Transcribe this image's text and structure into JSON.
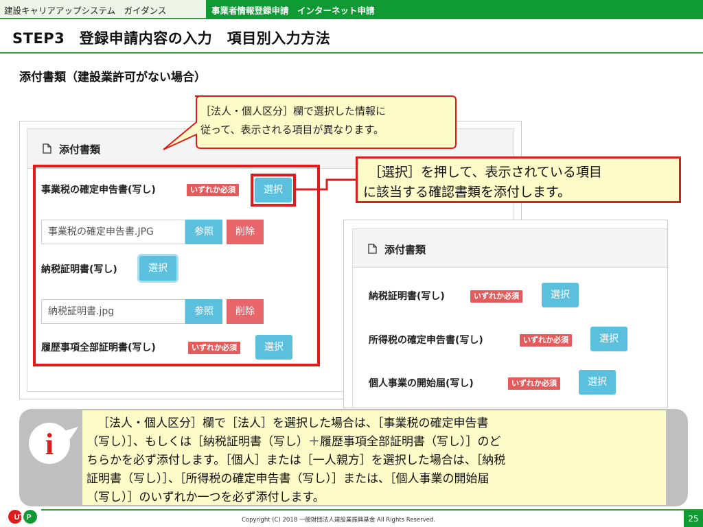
{
  "header": {
    "left_label": "建設キャリアアップシステム　ガイダンス",
    "right_label": "事業者情報登録申請　インターネット申請"
  },
  "title": "STEP3　登録申請内容の入力　項目別入力方法",
  "subtitle": "添付書類（建設業許可がない場合）",
  "bubble": {
    "line1": "［法人・個人区分］欄で選択した情報に",
    "line2": "従って、表示される項目が異なります。"
  },
  "panel_corp": {
    "heading": "添付書類",
    "items": [
      {
        "label": "事業税の確定申告書(写し)",
        "badge": "いずれか必須",
        "select": "選択"
      },
      {
        "file_name": "事業税の確定申告書.JPG",
        "ref": "参照",
        "delete": "削除"
      },
      {
        "label": "納税証明書(写し)",
        "select": "選択"
      },
      {
        "file_name": "納税証明書.jpg",
        "ref": "参照",
        "delete": "削除"
      },
      {
        "label": "履歴事項全部証明書(写し)",
        "badge": "いずれか必須",
        "select": "選択"
      }
    ]
  },
  "callout_red": {
    "line1": "［選択］を押して、表示されている項目",
    "line2": "に該当する確認書類を添付します。"
  },
  "panel_indiv": {
    "heading": "添付書類",
    "items": [
      {
        "label": "納税証明書(写し)",
        "badge": "いずれか必須",
        "select": "選択"
      },
      {
        "label": "所得税の確定申告書(写し)",
        "badge": "いずれか必須",
        "select": "選択"
      },
      {
        "label": "個人事業の開始届(写し)",
        "badge": "いずれか必須",
        "select": "選択"
      }
    ]
  },
  "info": {
    "icon_letter": "i",
    "lines": [
      "［法人・個人区分］欄で［法人］を選択した場合は、［事業税の確定申告書",
      "（写し）］、もしくは［納税証明書（写し）＋履歴事項全部証明書（写し）］のど",
      "ちらかを必ず添付します。［個人］または［一人親方］を選択した場合は、［納税",
      "証明書（写し）］、［所得税の確定申告書（写し）］または、［個人事業の開始届",
      "（写し）］のいずれか一つを必ず添付します。"
    ]
  },
  "footer": {
    "copyright": "Copyright (C) 2018 一般財団法人建設業振興基金 All Rights Reserved.",
    "page_number": "25",
    "logo_text": "UT P"
  },
  "colors": {
    "brand_green": "#0f9a34",
    "highlight_red": "#e11b1b",
    "button_blue": "#5bc0de",
    "badge_red": "#e35b5b",
    "callout_yellow": "#fdfbc8"
  }
}
